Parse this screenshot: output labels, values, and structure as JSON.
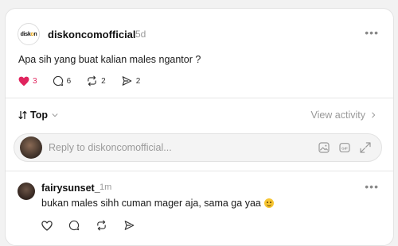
{
  "post": {
    "avatar_logo": "diskon",
    "username": "diskoncomofficial",
    "time": "5d",
    "text": "Apa sih yang buat kalian males ngantor ?",
    "likes": "3",
    "comments": "6",
    "reposts": "2",
    "shares": "2",
    "liked": true,
    "like_color": "#e0245e"
  },
  "sort": {
    "label": "Top",
    "view_activity": "View activity"
  },
  "reply": {
    "placeholder": "Reply to diskoncomofficial..."
  },
  "comment": {
    "username": "fairysunset_",
    "time": "1m",
    "text": "bukan males sihh cuman mager aja, sama ga yaa",
    "emoji": "grinning-face"
  }
}
